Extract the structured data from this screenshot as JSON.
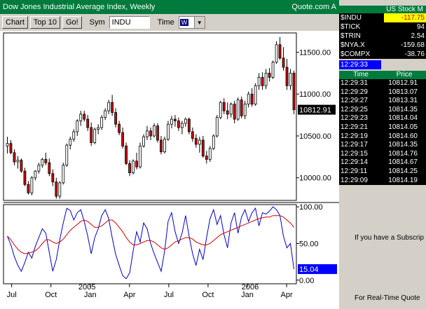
{
  "window": {
    "title": "Dow Jones Industrial Average Index, Weekly",
    "brand": "Quote.com  A"
  },
  "toolbar": {
    "chart_label": "Chart",
    "top10_label": "Top 10",
    "go_label": "Go!",
    "sym_label": "Sym",
    "sym_value": "INDU",
    "time_label": "Time",
    "time_value": "W"
  },
  "market": {
    "header": "US Stock M",
    "rows": [
      {
        "symbol": "$INDU",
        "value": "-117.75"
      },
      {
        "symbol": "$TICK",
        "value": "94"
      },
      {
        "symbol": "$TRIN",
        "value": "2.54"
      },
      {
        "symbol": "$NYA.X",
        "value": "-159.68"
      },
      {
        "symbol": "$COMPX",
        "value": "-38.76"
      }
    ],
    "clock": "12:29:33"
  },
  "trades": {
    "time_header": "Time",
    "price_header": "Price",
    "rows": [
      {
        "time": "12:29:31",
        "price": "10812.91"
      },
      {
        "time": "12:29:29",
        "price": "10813.07"
      },
      {
        "time": "12:29:27",
        "price": "10813.31"
      },
      {
        "time": "12:29:25",
        "price": "10814.35"
      },
      {
        "time": "12:29:23",
        "price": "10814.04"
      },
      {
        "time": "12:29:21",
        "price": "10814.05"
      },
      {
        "time": "12:29:19",
        "price": "10814.60"
      },
      {
        "time": "12:29:17",
        "price": "10814.35"
      },
      {
        "time": "12:29:15",
        "price": "10814.76"
      },
      {
        "time": "12:29:14",
        "price": "10814.67"
      },
      {
        "time": "12:29:11",
        "price": "10814.25"
      },
      {
        "time": "12:29:09",
        "price": "10814.19"
      }
    ]
  },
  "subscribe_text": "If you have a Subscrip",
  "realtime_text": "For Real-Time Quote",
  "colors": {
    "up": "#ffffff",
    "down": "#cc0000",
    "oscillator": "#0000cc",
    "signal": "#cc0000",
    "title_green": "#007a3d",
    "highlight": "#ffff00"
  },
  "chart_data": [
    {
      "type": "candlestick",
      "title": "Dow Jones Industrial Average Index, Weekly",
      "y_ticks": [
        10000,
        10500,
        11000,
        11500
      ],
      "y_tick_labels": [
        "10000.00",
        "10500.00",
        "11000.00",
        "11500.00"
      ],
      "ylim": [
        9730,
        11730
      ],
      "x_tick_labels": [
        "Jul",
        "Oct",
        "Jan",
        "Apr",
        "Jul",
        "Oct",
        "Jan",
        "Apr"
      ],
      "x_year_labels": [
        "2005",
        "2006"
      ],
      "last_value_label": "10812.91",
      "grid": false,
      "series": [
        {
          "o": 10380,
          "h": 10490,
          "l": 10290,
          "c": 10410
        },
        {
          "o": 10410,
          "h": 10450,
          "l": 10280,
          "c": 10300
        },
        {
          "o": 10300,
          "h": 10340,
          "l": 10150,
          "c": 10190
        },
        {
          "o": 10190,
          "h": 10260,
          "l": 10110,
          "c": 10210
        },
        {
          "o": 10210,
          "h": 10230,
          "l": 10060,
          "c": 10080
        },
        {
          "o": 10080,
          "h": 10120,
          "l": 9900,
          "c": 9920
        },
        {
          "o": 9920,
          "h": 9960,
          "l": 9800,
          "c": 9820
        },
        {
          "o": 9820,
          "h": 10020,
          "l": 9790,
          "c": 10000
        },
        {
          "o": 10000,
          "h": 10090,
          "l": 9970,
          "c": 10080
        },
        {
          "o": 10080,
          "h": 10180,
          "l": 10050,
          "c": 10150
        },
        {
          "o": 10150,
          "h": 10240,
          "l": 10120,
          "c": 10220
        },
        {
          "o": 10220,
          "h": 10300,
          "l": 10150,
          "c": 10180
        },
        {
          "o": 10180,
          "h": 10230,
          "l": 10020,
          "c": 10050
        },
        {
          "o": 10050,
          "h": 10100,
          "l": 9900,
          "c": 9950
        },
        {
          "o": 9950,
          "h": 10000,
          "l": 9750,
          "c": 9780
        },
        {
          "o": 9780,
          "h": 9960,
          "l": 9750,
          "c": 9940
        },
        {
          "o": 9940,
          "h": 10180,
          "l": 9920,
          "c": 10150
        },
        {
          "o": 10150,
          "h": 10410,
          "l": 10130,
          "c": 10390
        },
        {
          "o": 10390,
          "h": 10490,
          "l": 10340,
          "c": 10460
        },
        {
          "o": 10460,
          "h": 10580,
          "l": 10430,
          "c": 10550
        },
        {
          "o": 10550,
          "h": 10700,
          "l": 10500,
          "c": 10680
        },
        {
          "o": 10680,
          "h": 10800,
          "l": 10620,
          "c": 10760
        },
        {
          "o": 10760,
          "h": 10800,
          "l": 10670,
          "c": 10700
        },
        {
          "o": 10700,
          "h": 10750,
          "l": 10560,
          "c": 10600
        },
        {
          "o": 10600,
          "h": 10660,
          "l": 10380,
          "c": 10420
        },
        {
          "o": 10420,
          "h": 10600,
          "l": 10400,
          "c": 10580
        },
        {
          "o": 10580,
          "h": 10640,
          "l": 10520,
          "c": 10600
        },
        {
          "o": 10600,
          "h": 10750,
          "l": 10570,
          "c": 10720
        },
        {
          "o": 10720,
          "h": 10830,
          "l": 10690,
          "c": 10800
        },
        {
          "o": 10800,
          "h": 10930,
          "l": 10760,
          "c": 10900
        },
        {
          "o": 10900,
          "h": 10990,
          "l": 10740,
          "c": 10780
        },
        {
          "o": 10780,
          "h": 10830,
          "l": 10600,
          "c": 10640
        },
        {
          "o": 10640,
          "h": 10680,
          "l": 10510,
          "c": 10540
        },
        {
          "o": 10540,
          "h": 10600,
          "l": 10350,
          "c": 10380
        },
        {
          "o": 10380,
          "h": 10420,
          "l": 10150,
          "c": 10170
        },
        {
          "o": 10170,
          "h": 10210,
          "l": 10020,
          "c": 10060
        },
        {
          "o": 10060,
          "h": 10220,
          "l": 10040,
          "c": 10200
        },
        {
          "o": 10200,
          "h": 10300,
          "l": 10100,
          "c": 10130
        },
        {
          "o": 10130,
          "h": 10420,
          "l": 10110,
          "c": 10380
        },
        {
          "o": 10380,
          "h": 10520,
          "l": 10360,
          "c": 10490
        },
        {
          "o": 10490,
          "h": 10620,
          "l": 10450,
          "c": 10560
        },
        {
          "o": 10560,
          "h": 10600,
          "l": 10450,
          "c": 10500
        },
        {
          "o": 10500,
          "h": 10650,
          "l": 10480,
          "c": 10620
        },
        {
          "o": 10620,
          "h": 10650,
          "l": 10420,
          "c": 10450
        },
        {
          "o": 10450,
          "h": 10500,
          "l": 10280,
          "c": 10310
        },
        {
          "o": 10310,
          "h": 10490,
          "l": 10290,
          "c": 10460
        },
        {
          "o": 10460,
          "h": 10680,
          "l": 10440,
          "c": 10640
        },
        {
          "o": 10640,
          "h": 10740,
          "l": 10590,
          "c": 10700
        },
        {
          "o": 10700,
          "h": 10750,
          "l": 10610,
          "c": 10680
        },
        {
          "o": 10680,
          "h": 10720,
          "l": 10560,
          "c": 10600
        },
        {
          "o": 10600,
          "h": 10680,
          "l": 10520,
          "c": 10650
        },
        {
          "o": 10650,
          "h": 10720,
          "l": 10610,
          "c": 10700
        },
        {
          "o": 10700,
          "h": 10720,
          "l": 10520,
          "c": 10550
        },
        {
          "o": 10550,
          "h": 10600,
          "l": 10430,
          "c": 10470
        },
        {
          "o": 10470,
          "h": 10520,
          "l": 10360,
          "c": 10400
        },
        {
          "o": 10400,
          "h": 10490,
          "l": 10300,
          "c": 10450
        },
        {
          "o": 10450,
          "h": 10500,
          "l": 10240,
          "c": 10260
        },
        {
          "o": 10260,
          "h": 10320,
          "l": 10170,
          "c": 10220
        },
        {
          "o": 10220,
          "h": 10380,
          "l": 10190,
          "c": 10350
        },
        {
          "o": 10350,
          "h": 10520,
          "l": 10330,
          "c": 10500
        },
        {
          "o": 10500,
          "h": 10750,
          "l": 10480,
          "c": 10720
        },
        {
          "o": 10720,
          "h": 10920,
          "l": 10700,
          "c": 10900
        },
        {
          "o": 10900,
          "h": 10950,
          "l": 10760,
          "c": 10800
        },
        {
          "o": 10800,
          "h": 10900,
          "l": 10700,
          "c": 10760
        },
        {
          "o": 10760,
          "h": 10900,
          "l": 10720,
          "c": 10880
        },
        {
          "o": 10880,
          "h": 10920,
          "l": 10650,
          "c": 10700
        },
        {
          "o": 10700,
          "h": 10960,
          "l": 10680,
          "c": 10930
        },
        {
          "o": 10930,
          "h": 10970,
          "l": 10710,
          "c": 10740
        },
        {
          "o": 10740,
          "h": 10920,
          "l": 10700,
          "c": 10880
        },
        {
          "o": 10880,
          "h": 11030,
          "l": 10840,
          "c": 11000
        },
        {
          "o": 11000,
          "h": 11070,
          "l": 10850,
          "c": 10880
        },
        {
          "o": 10880,
          "h": 11130,
          "l": 10860,
          "c": 11100
        },
        {
          "o": 11100,
          "h": 11250,
          "l": 11050,
          "c": 11200
        },
        {
          "o": 11200,
          "h": 11260,
          "l": 11050,
          "c": 11100
        },
        {
          "o": 11100,
          "h": 11300,
          "l": 11060,
          "c": 11250
        },
        {
          "o": 11250,
          "h": 11310,
          "l": 11150,
          "c": 11200
        },
        {
          "o": 11200,
          "h": 11400,
          "l": 11180,
          "c": 11380
        },
        {
          "o": 11380,
          "h": 11630,
          "l": 11360,
          "c": 11590
        },
        {
          "o": 11590,
          "h": 11680,
          "l": 11410,
          "c": 11430
        },
        {
          "o": 11430,
          "h": 11560,
          "l": 11280,
          "c": 11320
        },
        {
          "o": 11320,
          "h": 11420,
          "l": 11050,
          "c": 11100
        },
        {
          "o": 11100,
          "h": 11300,
          "l": 11050,
          "c": 11250
        },
        {
          "o": 11250,
          "h": 11280,
          "l": 10760,
          "c": 10813
        }
      ]
    },
    {
      "type": "line",
      "y_ticks": [
        0,
        50,
        100
      ],
      "y_tick_labels": [
        "0.00",
        "50.00",
        "100.00"
      ],
      "ylim": [
        -5,
        103
      ],
      "last_value_label": "15.04",
      "grid": false,
      "series": [
        {
          "name": "oscillator",
          "color": "#0000cc",
          "values": [
            60,
            48,
            32,
            20,
            12,
            24,
            38,
            30,
            46,
            58,
            70,
            64,
            38,
            12,
            28,
            55,
            78,
            98,
            95,
            82,
            92,
            96,
            80,
            60,
            36,
            58,
            70,
            88,
            96,
            84,
            58,
            35,
            20,
            6,
            2,
            10,
            40,
            66,
            52,
            78,
            70,
            50,
            36,
            24,
            12,
            40,
            80,
            92,
            66,
            50,
            64,
            88,
            60,
            36,
            20,
            42,
            28,
            58,
            84,
            96,
            76,
            88,
            62,
            44,
            78,
            92,
            64,
            86,
            96,
            80,
            92,
            98,
            74,
            92,
            90,
            94,
            100,
            96,
            88,
            60,
            44,
            50,
            15
          ]
        },
        {
          "name": "signal",
          "color": "#cc0000",
          "values": [
            60,
            55,
            48,
            42,
            38,
            36,
            37,
            38,
            40,
            44,
            50,
            55,
            55,
            52,
            50,
            52,
            56,
            62,
            68,
            72,
            76,
            80,
            82,
            80,
            76,
            72,
            72,
            74,
            78,
            82,
            82,
            78,
            72,
            66,
            58,
            52,
            48,
            48,
            50,
            52,
            54,
            54,
            52,
            48,
            44,
            42,
            44,
            48,
            52,
            54,
            56,
            58,
            58,
            56,
            52,
            50,
            48,
            48,
            50,
            54,
            58,
            62,
            64,
            66,
            68,
            70,
            72,
            74,
            76,
            78,
            80,
            82,
            84,
            85,
            86,
            86,
            88,
            88,
            88,
            86,
            82,
            78,
            72
          ]
        }
      ]
    }
  ]
}
